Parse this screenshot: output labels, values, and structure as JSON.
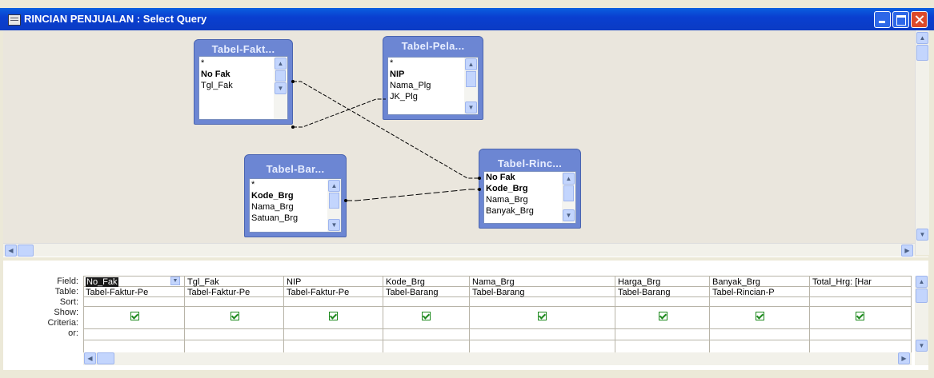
{
  "window": {
    "title": "RINCIAN PENJUALAN : Select Query",
    "min_glyph": "",
    "close_glyph": ""
  },
  "tables": [
    {
      "title": "Tabel-Fakt...",
      "fields": [
        "*",
        "No Fak",
        "Tgl_Fak"
      ],
      "keys": [
        false,
        true,
        false
      ]
    },
    {
      "title": "Tabel-Pela...",
      "fields": [
        "*",
        "NIP",
        "Nama_Plg",
        "JK_Plg"
      ],
      "keys": [
        false,
        true,
        false,
        false
      ]
    },
    {
      "title": "Tabel-Bar...",
      "fields": [
        "*",
        "Kode_Brg",
        "Nama_Brg",
        "Satuan_Brg"
      ],
      "keys": [
        false,
        true,
        false,
        false
      ]
    },
    {
      "title": "Tabel-Rinc...",
      "fields": [
        "No Fak",
        "Kode_Brg",
        "Nama_Brg",
        "Banyak_Brg"
      ],
      "keys": [
        true,
        true,
        false,
        false
      ]
    }
  ],
  "grid": {
    "row_labels": [
      "Field:",
      "Table:",
      "Sort:",
      "Show:",
      "Criteria:",
      "or:"
    ],
    "columns": [
      {
        "field": "No_Fak",
        "table": "Tabel-Faktur-Pe",
        "show": true
      },
      {
        "field": "Tgl_Fak",
        "table": "Tabel-Faktur-Pe",
        "show": true
      },
      {
        "field": "NIP",
        "table": "Tabel-Faktur-Pe",
        "show": true
      },
      {
        "field": "Kode_Brg",
        "table": "Tabel-Barang",
        "show": true
      },
      {
        "field": "Nama_Brg",
        "table": "Tabel-Barang",
        "show": true
      },
      {
        "field": "Harga_Brg",
        "table": "Tabel-Barang",
        "show": true
      },
      {
        "field": "Banyak_Brg",
        "table": "Tabel-Rincian-P",
        "show": true
      },
      {
        "field": "Total_Hrg: [Har",
        "table": "",
        "show": true
      }
    ]
  }
}
